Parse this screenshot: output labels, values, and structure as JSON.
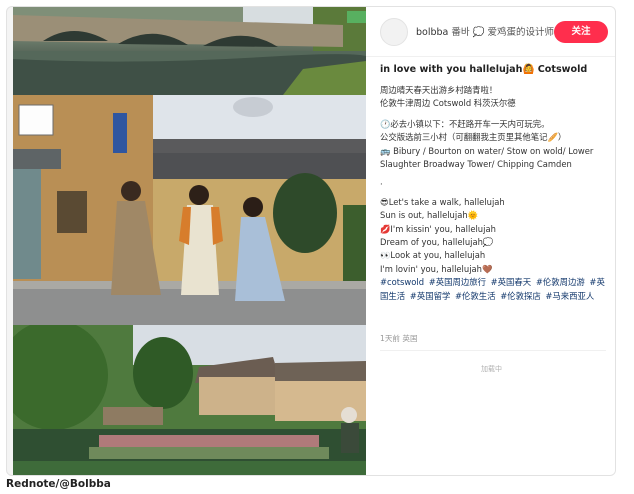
{
  "author": {
    "name": "bolbba",
    "subtitle": "番바 💭 爱鸡蛋的设计师",
    "follow_label": "关注"
  },
  "post": {
    "title": "in love with you hallelujah🙆 Cotswold",
    "lines_block1": [
      "周边晴天春天出游乡村踏青啦！",
      "伦敦牛津周边 Cotswold 科茨沃尔德"
    ],
    "lines_block2": [
      "🕐必去小镇以下：不赶路开车一天内可玩完。",
      "公交版选前三小村（可翻翻我主页里其他笔记🥖）",
      "🚌 Bibury / Bourton on water/ Stow on wold/ Lower",
      "Slaughter Broadway Tower/ Chipping Camden"
    ],
    "lines_block3": [
      "😎Let's take a walk, hallelujah",
      "Sun is out, hallelujah🌞",
      "💋I'm kissin' you, hallelujah",
      "Dream of you, hallelujah💭",
      "👀Look at you, hallelujah",
      "I'm lovin' you, hallelujah🤎"
    ],
    "tags": [
      "#cotswold",
      "#英国周边旅行",
      "#英国春天",
      "#伦敦周边游",
      "#英国生活",
      "#英国留学",
      "#伦敦生活",
      "#伦敦探店",
      "#马来西亚人"
    ],
    "meta": "1天前 英国",
    "loading": "加载中"
  },
  "credit": "Rednote/@Bolbba",
  "colors": {
    "follow": "#ff2e4d",
    "tag": "#13386c"
  }
}
